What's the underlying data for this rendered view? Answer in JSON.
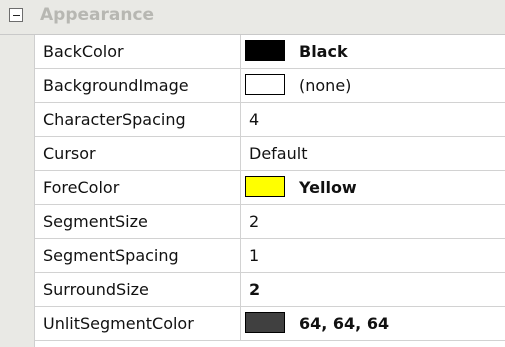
{
  "category": {
    "label": "Appearance",
    "collapse_glyph": "minus"
  },
  "properties": [
    {
      "name": "BackColor",
      "value": "Black",
      "bold": true,
      "swatch": "#000000"
    },
    {
      "name": "BackgroundImage",
      "value": "(none)",
      "bold": false,
      "swatch": "#ffffff"
    },
    {
      "name": "CharacterSpacing",
      "value": "4",
      "bold": false
    },
    {
      "name": "Cursor",
      "value": "Default",
      "bold": false
    },
    {
      "name": "ForeColor",
      "value": "Yellow",
      "bold": true,
      "swatch": "#ffff00"
    },
    {
      "name": "SegmentSize",
      "value": "2",
      "bold": false
    },
    {
      "name": "SegmentSpacing",
      "value": "1",
      "bold": false
    },
    {
      "name": "SurroundSize",
      "value": "2",
      "bold": true
    },
    {
      "name": "UnlitSegmentColor",
      "value": "64, 64, 64",
      "bold": true,
      "swatch": "#404040"
    }
  ]
}
